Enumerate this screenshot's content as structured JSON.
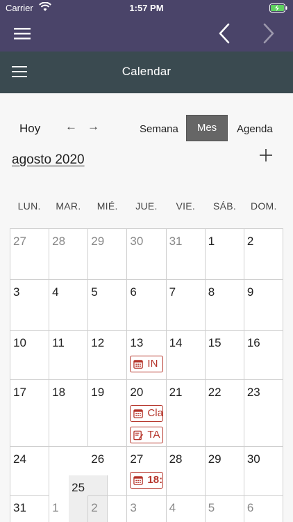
{
  "status": {
    "carrier": "Carrier",
    "time": "1:57 PM"
  },
  "appbar": {
    "title": "Calendar"
  },
  "toolbar": {
    "today": "Hoy",
    "prev": "←",
    "next": "→",
    "views": [
      "Semana",
      "Mes",
      "Agenda"
    ],
    "active_view": "Mes",
    "month_title": "agosto 2020",
    "add": "+"
  },
  "weekdays": [
    "LUN.",
    "MAR.",
    "MIÉ.",
    "JUE.",
    "VIE.",
    "SÁB.",
    "DOM."
  ],
  "weeks": [
    {
      "days": [
        {
          "n": "27",
          "out": true
        },
        {
          "n": "28",
          "out": true
        },
        {
          "n": "29",
          "out": true
        },
        {
          "n": "30",
          "out": true
        },
        {
          "n": "31",
          "out": true
        },
        {
          "n": "1"
        },
        {
          "n": "2"
        }
      ]
    },
    {
      "days": [
        {
          "n": "3"
        },
        {
          "n": "4"
        },
        {
          "n": "5"
        },
        {
          "n": "6"
        },
        {
          "n": "7"
        },
        {
          "n": "8"
        },
        {
          "n": "9"
        }
      ]
    },
    {
      "days": [
        {
          "n": "10"
        },
        {
          "n": "11"
        },
        {
          "n": "12"
        },
        {
          "n": "13",
          "events": [
            {
              "icon": "calendar-icon",
              "text": "IN"
            }
          ]
        },
        {
          "n": "14"
        },
        {
          "n": "15"
        },
        {
          "n": "16"
        }
      ]
    },
    {
      "days": [
        {
          "n": "17"
        },
        {
          "n": "18"
        },
        {
          "n": "19"
        },
        {
          "n": "20",
          "events": [
            {
              "icon": "calendar-icon",
              "text": "Cla"
            },
            {
              "icon": "edit-icon",
              "text": "TA"
            }
          ]
        },
        {
          "n": "21"
        },
        {
          "n": "22"
        },
        {
          "n": "23"
        }
      ]
    },
    {
      "days": [
        {
          "n": "24"
        },
        {
          "n": "25",
          "today": true
        },
        {
          "n": "26"
        },
        {
          "n": "27",
          "events": [
            {
              "icon": "calendar-icon",
              "text": "18:",
              "bold": true
            }
          ]
        },
        {
          "n": "28"
        },
        {
          "n": "29"
        },
        {
          "n": "30"
        }
      ]
    },
    {
      "days": [
        {
          "n": "31"
        },
        {
          "n": "1",
          "out": true
        },
        {
          "n": "2",
          "out": true
        },
        {
          "n": "3",
          "out": true
        },
        {
          "n": "4",
          "out": true
        },
        {
          "n": "5",
          "out": true
        },
        {
          "n": "6",
          "out": true
        }
      ]
    }
  ],
  "colors": {
    "statusbar": "#4a4469",
    "appbar": "#3a4a50",
    "event": "#b5342a",
    "active_view": "#666666"
  }
}
